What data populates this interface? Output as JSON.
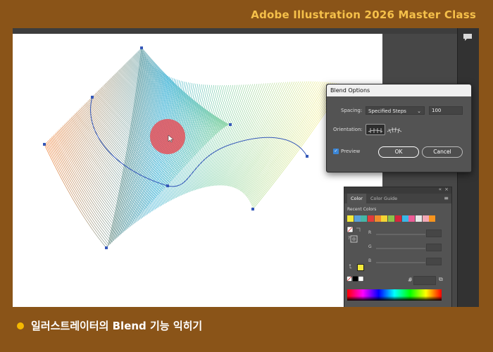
{
  "header": {
    "course_title": "Adobe Illustration 2026 Master Class"
  },
  "caption": {
    "text": "일러스트레이터의 Blend 기능 익히기"
  },
  "icons": {
    "comment": "speech-bubble-icon",
    "orientation_align_page": "align-to-page-icon",
    "orientation_align_path": "align-to-path-icon",
    "checkbox": "checkmark-icon"
  },
  "blend_dialog": {
    "title": "Blend Options",
    "spacing_label": "Spacing:",
    "spacing_value": "Specified Steps",
    "steps_value": "100",
    "orientation_label": "Orientation:",
    "preview_label": "Preview",
    "preview_checked": true,
    "ok_label": "OK",
    "cancel_label": "Cancel"
  },
  "color_panel": {
    "tabs": [
      "Color",
      "Color Guide"
    ],
    "active_tab": "Color",
    "recent_label": "Recent Colors",
    "recent_colors": [
      "#f4ea3a",
      "#5aa0d8",
      "#46b6a6",
      "#e23b3b",
      "#f08c2c",
      "#f4d433",
      "#8cc34a",
      "#d7263d",
      "#37b7e8",
      "#ec5c96",
      "#e7e7e7",
      "#f2a7b5",
      "#f7941d"
    ],
    "channels": [
      "R",
      "G",
      "B"
    ],
    "hex_label": "#"
  },
  "colors": {
    "frame_bg": "#8a5418",
    "accent_title": "#f5c04a",
    "bullet": "#f5b800",
    "blend_start": "#f07a2a",
    "blend_mid": "#46b6d8",
    "blend_end": "#f2ee8c",
    "cursor_highlight": "#e84a52"
  }
}
